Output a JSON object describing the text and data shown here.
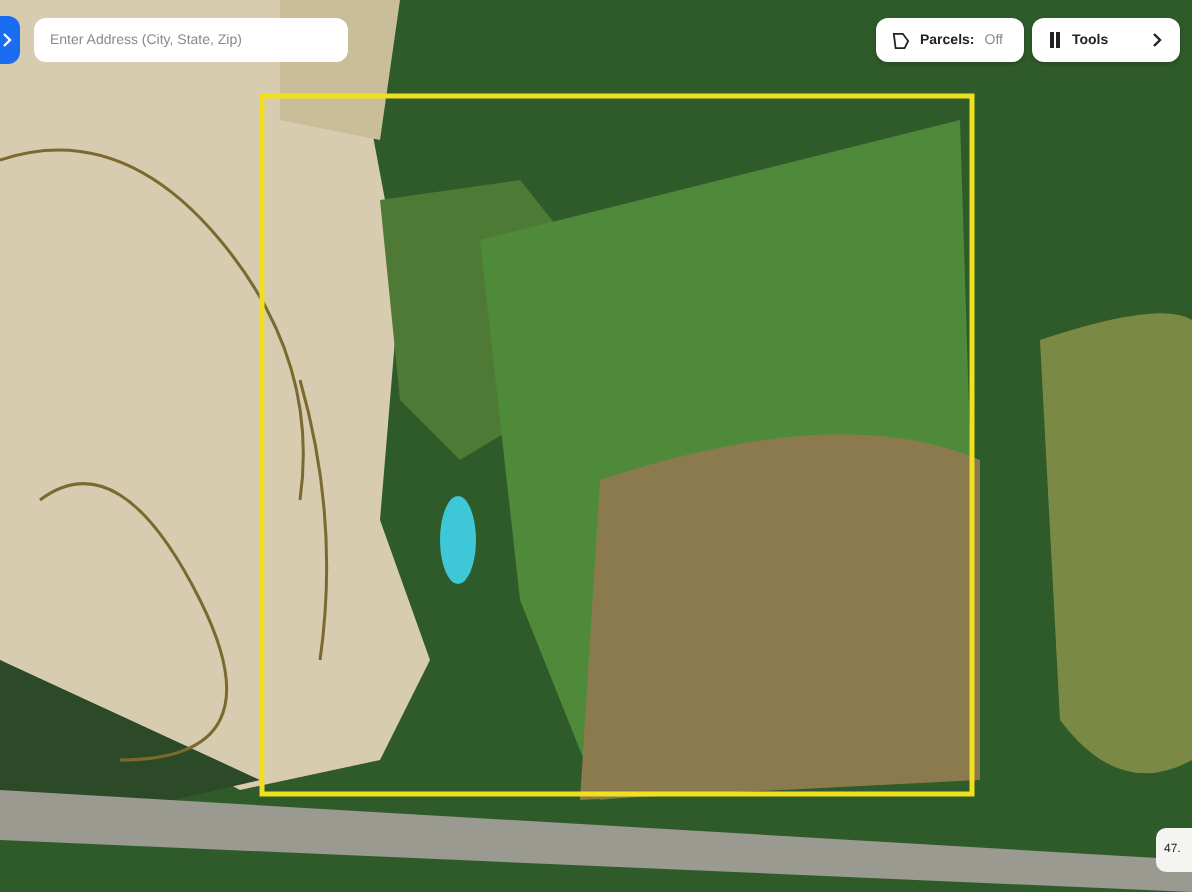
{
  "search": {
    "placeholder": "Enter Address (City, State, Zip)"
  },
  "parcels": {
    "label": "Parcels:",
    "value": "Off",
    "on": false
  },
  "tools": {
    "label": "Tools"
  },
  "readout": "47."
}
